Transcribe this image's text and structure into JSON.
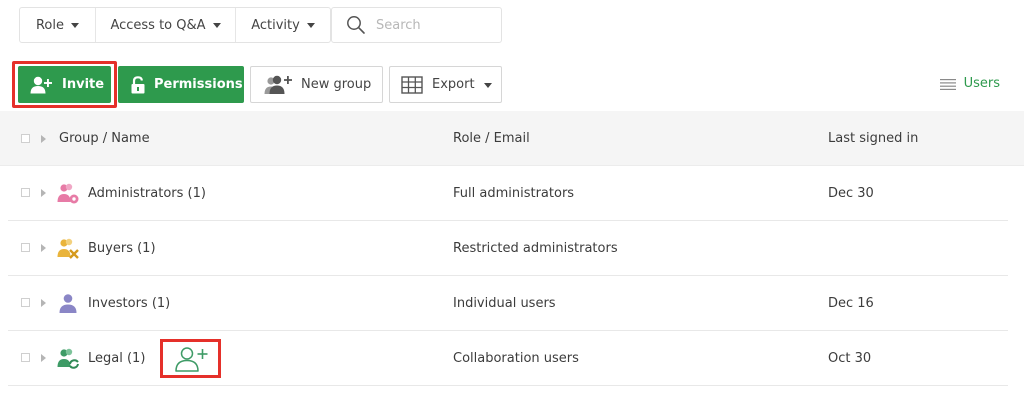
{
  "filters": {
    "role": "Role",
    "access": "Access to Q&A",
    "activity": "Activity"
  },
  "search": {
    "placeholder": "Search",
    "value": ""
  },
  "toolbar": {
    "invite": "Invite",
    "permissions": "Permissions",
    "new_group": "New group",
    "export": "Export",
    "users": "Users"
  },
  "table": {
    "headers": {
      "name": "Group / Name",
      "role": "Role / Email",
      "last": "Last signed in"
    },
    "rows": [
      {
        "name": "Administrators (1)",
        "role": "Full administrators",
        "last": "Dec 30",
        "icon": "administrators-group-icon"
      },
      {
        "name": "Buyers (1)",
        "role": "Restricted administrators",
        "last": "",
        "icon": "buyers-group-icon"
      },
      {
        "name": "Investors (1)",
        "role": "Individual users",
        "last": "Dec 16",
        "icon": "investors-group-icon"
      },
      {
        "name": "Legal (1)",
        "role": "Collaboration users",
        "last": "Oct 30",
        "icon": "legal-group-icon"
      }
    ]
  },
  "colors": {
    "accent_green": "#2e9a4d",
    "highlight_red": "#e5302a",
    "admin_pink": "#e77ba6",
    "buyer_yellow": "#e9b43c",
    "investor_purple": "#8a86c6",
    "legal_green": "#3e9b66"
  }
}
